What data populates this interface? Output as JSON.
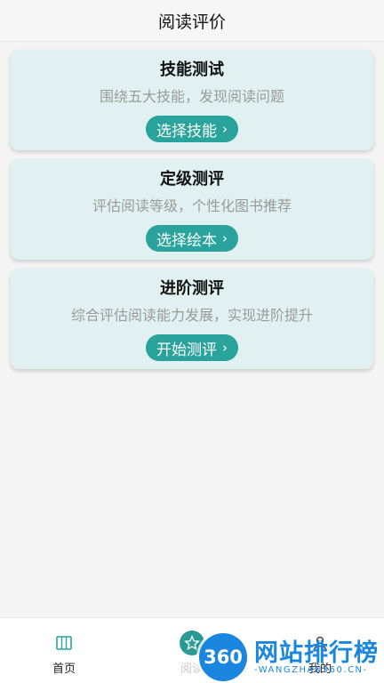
{
  "header": {
    "title": "阅读评价"
  },
  "cards": [
    {
      "title": "技能测试",
      "desc": "围绕五大技能，发现阅读问题",
      "button": "选择技能"
    },
    {
      "title": "定级测评",
      "desc": "评估阅读等级，个性化图书推荐",
      "button": "选择绘本"
    },
    {
      "title": "进阶测评",
      "desc": "综合评估阅读能力发展，实现进阶提升",
      "button": "开始测评"
    }
  ],
  "tabs": [
    {
      "label": "首页",
      "icon": "book-icon"
    },
    {
      "label": "阅读",
      "icon": "star-icon"
    },
    {
      "label": "我的",
      "icon": "person-icon"
    }
  ],
  "watermark": {
    "badge": "360",
    "text": "网站排行榜",
    "sub": "-WANGZHAN360.CN-"
  },
  "colors": {
    "accent": "#2aa39c",
    "card_bg": "#e1f1f1",
    "watermark": "#1a86e0"
  }
}
